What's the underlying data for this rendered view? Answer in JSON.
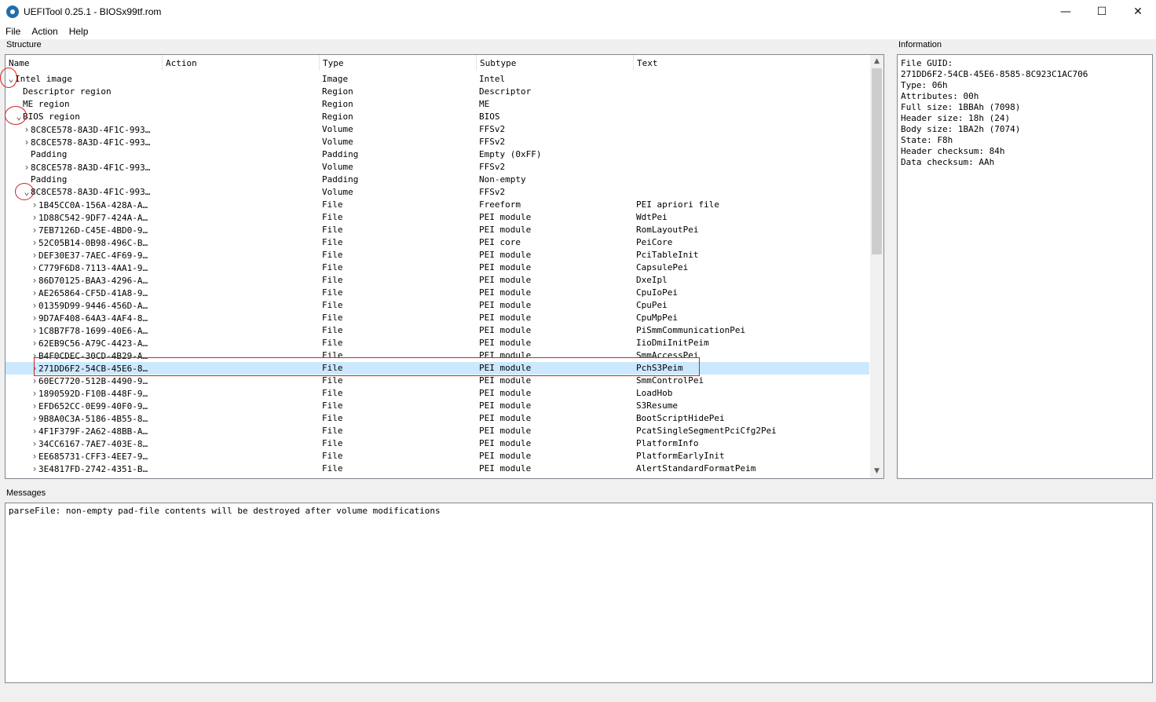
{
  "window": {
    "title": "UEFITool 0.25.1 - BIOSx99tf.rom",
    "minimize": "—",
    "maximize": "☐",
    "close": "✕"
  },
  "menu": [
    "File",
    "Action",
    "Help"
  ],
  "structure": {
    "label": "Structure",
    "columns": [
      "Name",
      "Action",
      "Type",
      "Subtype",
      "Text"
    ],
    "rows": [
      {
        "level": 0,
        "arrow": "open",
        "name": "Intel image",
        "type": "Image",
        "subtype": "Intel",
        "text": ""
      },
      {
        "level": 1,
        "arrow": "",
        "name": "Descriptor region",
        "type": "Region",
        "subtype": "Descriptor",
        "text": ""
      },
      {
        "level": 1,
        "arrow": "",
        "name": "ME region",
        "type": "Region",
        "subtype": "ME",
        "text": ""
      },
      {
        "level": 1,
        "arrow": "open",
        "name": "BIOS region",
        "type": "Region",
        "subtype": "BIOS",
        "text": ""
      },
      {
        "level": 2,
        "arrow": "closed",
        "name": "8C8CE578-8A3D-4F1C-993…",
        "type": "Volume",
        "subtype": "FFSv2",
        "text": ""
      },
      {
        "level": 2,
        "arrow": "closed",
        "name": "8C8CE578-8A3D-4F1C-993…",
        "type": "Volume",
        "subtype": "FFSv2",
        "text": ""
      },
      {
        "level": 2,
        "arrow": "",
        "name": "Padding",
        "type": "Padding",
        "subtype": "Empty (0xFF)",
        "text": ""
      },
      {
        "level": 2,
        "arrow": "closed",
        "name": "8C8CE578-8A3D-4F1C-993…",
        "type": "Volume",
        "subtype": "FFSv2",
        "text": ""
      },
      {
        "level": 2,
        "arrow": "",
        "name": "Padding",
        "type": "Padding",
        "subtype": "Non-empty",
        "text": ""
      },
      {
        "level": 2,
        "arrow": "open",
        "name": "8C8CE578-8A3D-4F1C-993…",
        "type": "Volume",
        "subtype": "FFSv2",
        "text": ""
      },
      {
        "level": 3,
        "arrow": "closed",
        "name": "1B45CC0A-156A-428A-A…",
        "type": "File",
        "subtype": "Freeform",
        "text": "PEI apriori file"
      },
      {
        "level": 3,
        "arrow": "closed",
        "name": "1D88C542-9DF7-424A-A…",
        "type": "File",
        "subtype": "PEI module",
        "text": "WdtPei"
      },
      {
        "level": 3,
        "arrow": "closed",
        "name": "7EB7126D-C45E-4BD0-9…",
        "type": "File",
        "subtype": "PEI module",
        "text": "RomLayoutPei"
      },
      {
        "level": 3,
        "arrow": "closed",
        "name": "52C05B14-0B98-496C-B…",
        "type": "File",
        "subtype": "PEI core",
        "text": "PeiCore"
      },
      {
        "level": 3,
        "arrow": "closed",
        "name": "DEF30E37-7AEC-4F69-9…",
        "type": "File",
        "subtype": "PEI module",
        "text": "PciTableInit"
      },
      {
        "level": 3,
        "arrow": "closed",
        "name": "C779F6D8-7113-4AA1-9…",
        "type": "File",
        "subtype": "PEI module",
        "text": "CapsulePei"
      },
      {
        "level": 3,
        "arrow": "closed",
        "name": "86D70125-BAA3-4296-A…",
        "type": "File",
        "subtype": "PEI module",
        "text": "DxeIpl"
      },
      {
        "level": 3,
        "arrow": "closed",
        "name": "AE265864-CF5D-41A8-9…",
        "type": "File",
        "subtype": "PEI module",
        "text": "CpuIoPei"
      },
      {
        "level": 3,
        "arrow": "closed",
        "name": "01359D99-9446-456D-A…",
        "type": "File",
        "subtype": "PEI module",
        "text": "CpuPei"
      },
      {
        "level": 3,
        "arrow": "closed",
        "name": "9D7AF408-64A3-4AF4-8…",
        "type": "File",
        "subtype": "PEI module",
        "text": "CpuMpPei"
      },
      {
        "level": 3,
        "arrow": "closed",
        "name": "1C8B7F78-1699-40E6-A…",
        "type": "File",
        "subtype": "PEI module",
        "text": "PiSmmCommunicationPei"
      },
      {
        "level": 3,
        "arrow": "closed",
        "name": "62EB9C56-A79C-4423-A…",
        "type": "File",
        "subtype": "PEI module",
        "text": "IioDmiInitPeim"
      },
      {
        "level": 3,
        "arrow": "closed",
        "name": "B4F0CDEC-30CD-4B29-A…",
        "type": "File",
        "subtype": "PEI module",
        "text": "SmmAccessPei"
      },
      {
        "level": 3,
        "arrow": "closed",
        "name": "271DD6F2-54CB-45E6-8…",
        "type": "File",
        "subtype": "PEI module",
        "text": "PchS3Peim",
        "selected": true
      },
      {
        "level": 3,
        "arrow": "closed",
        "name": "60EC7720-512B-4490-9…",
        "type": "File",
        "subtype": "PEI module",
        "text": "SmmControlPei"
      },
      {
        "level": 3,
        "arrow": "closed",
        "name": "1890592D-F10B-448F-9…",
        "type": "File",
        "subtype": "PEI module",
        "text": "LoadHob"
      },
      {
        "level": 3,
        "arrow": "closed",
        "name": "EFD652CC-0E99-40F0-9…",
        "type": "File",
        "subtype": "PEI module",
        "text": "S3Resume"
      },
      {
        "level": 3,
        "arrow": "closed",
        "name": "9B8A0C3A-5186-4B55-8…",
        "type": "File",
        "subtype": "PEI module",
        "text": "BootScriptHidePei"
      },
      {
        "level": 3,
        "arrow": "closed",
        "name": "4F1F379F-2A62-48BB-A…",
        "type": "File",
        "subtype": "PEI module",
        "text": "PcatSingleSegmentPciCfg2Pei"
      },
      {
        "level": 3,
        "arrow": "closed",
        "name": "34CC6167-7AE7-403E-8…",
        "type": "File",
        "subtype": "PEI module",
        "text": "PlatformInfo"
      },
      {
        "level": 3,
        "arrow": "closed",
        "name": "EE685731-CFF3-4EE7-9…",
        "type": "File",
        "subtype": "PEI module",
        "text": "PlatformEarlyInit"
      },
      {
        "level": 3,
        "arrow": "closed",
        "name": "3E4817FD-2742-4351-B…",
        "type": "File",
        "subtype": "PEI module",
        "text": "AlertStandardFormatPeim"
      }
    ]
  },
  "information": {
    "label": "Information",
    "lines": [
      "File GUID:",
      "271DD6F2-54CB-45E6-8585-8C923C1AC706",
      "Type: 06h",
      "Attributes: 00h",
      "Full size: 1BBAh (7098)",
      "Header size: 18h (24)",
      "Body size: 1BA2h (7074)",
      "State: F8h",
      "Header checksum: 84h",
      "Data checksum: AAh"
    ]
  },
  "messages": {
    "label": "Messages",
    "lines": [
      "parseFile: non-empty pad-file contents will be destroyed after volume modifications"
    ]
  },
  "icons": {
    "app": "uefitool-gear-icon",
    "expanded": "chevron-down-icon",
    "collapsed": "chevron-right-icon",
    "scroll_up": "scroll-up-icon",
    "scroll_down": "scroll-down-icon"
  },
  "colors": {
    "selection": "#cce8ff",
    "annotation": "#d62020"
  }
}
